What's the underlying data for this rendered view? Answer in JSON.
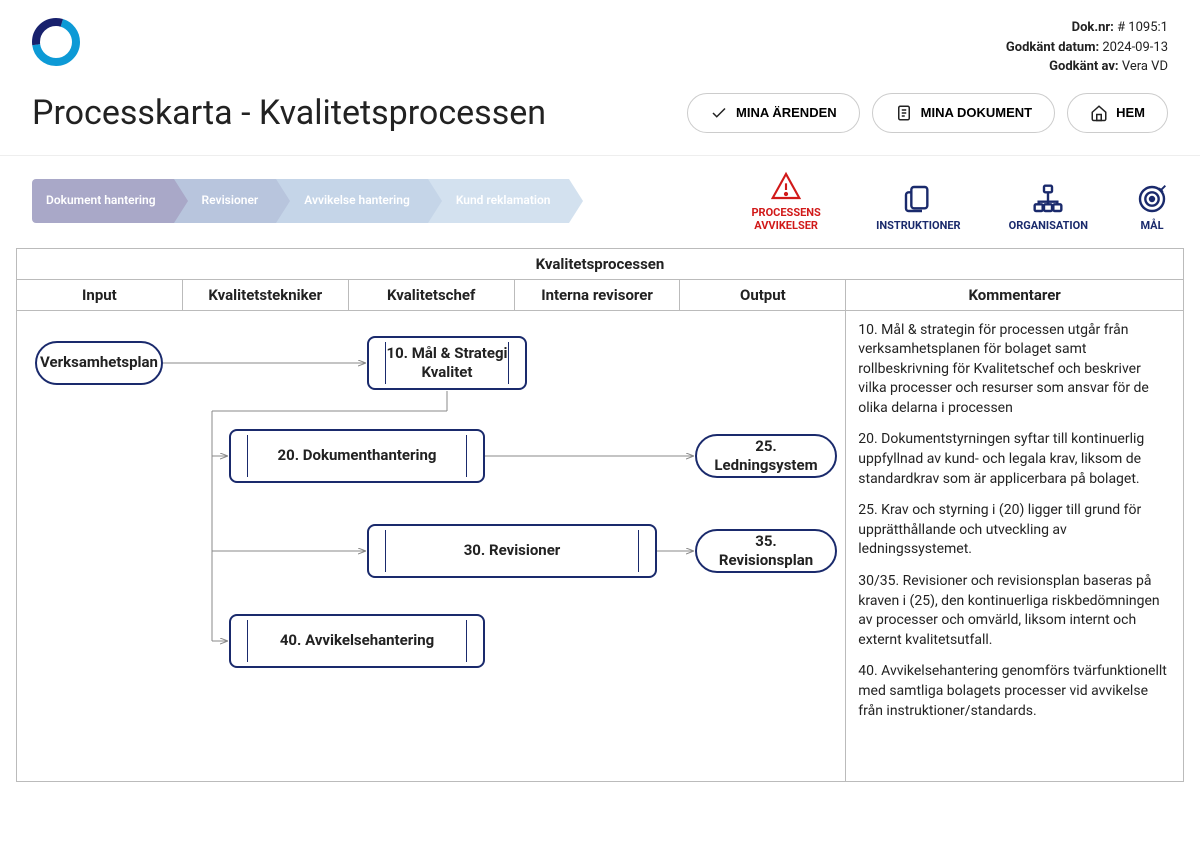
{
  "meta": {
    "dok_label": "Dok.nr:",
    "dok_value": "# 1095:1",
    "date_label": "Godkänt datum:",
    "date_value": "2024-09-13",
    "by_label": "Godkänt av:",
    "by_value": "Vera VD"
  },
  "title": "Processkarta - Kvalitetsprocessen",
  "buttons": {
    "arenden": "MINA ÄRENDEN",
    "dokument": "MINA DOKUMENT",
    "hem": "HEM"
  },
  "crumbs": [
    "Dokument hantering",
    "Revisioner",
    "Avvikelse hantering",
    "Kund reklamation"
  ],
  "sidelinks": {
    "avvikelser": "PROCESSENS AVVIKELSER",
    "instruktioner": "INSTRUKTIONER",
    "organisation": "ORGANISATION",
    "mal": "MÅL"
  },
  "swimlane": {
    "super": "Kvalitetsprocessen",
    "cols": [
      "Input",
      "Kvalitetstekniker",
      "Kvalitetschef",
      "Interna revisorer",
      "Output",
      "Kommentarer"
    ]
  },
  "nodes": {
    "verksamhetsplan": "Verksamhetsplan",
    "n10": "10. Mål & Strategi Kvalitet",
    "n20": "20. Dokumenthantering",
    "n25": "25. Ledningsystem",
    "n30": "30. Revisioner",
    "n35": "35. Revisionsplan",
    "n40": "40. Avvikelsehantering"
  },
  "comments": [
    "10. Mål & strategin för processen utgår från verksamhetsplanen för bolaget samt rollbeskrivning för Kvalitetschef och beskriver vilka processer och resurser som ansvar för de olika delarna i processen",
    "20. Dokumentstyrningen syftar till kontinuerlig uppfyllnad av kund- och legala krav, liksom de standardkrav som är applicerbara på bolaget.",
    "25. Krav och styrning i (20) ligger till grund för upprätthållande och utveckling av ledningssystemet.",
    "30/35. Revisioner och revisionsplan baseras på kraven i (25), den kontinuerliga riskbedömningen av processer och omvärld, liksom internt och externt kvalitetsutfall.",
    "40. Avvikelsehantering genomförs tvärfunktionellt med samtliga bolagets processer vid avvikelse från instruktioner/standards."
  ]
}
